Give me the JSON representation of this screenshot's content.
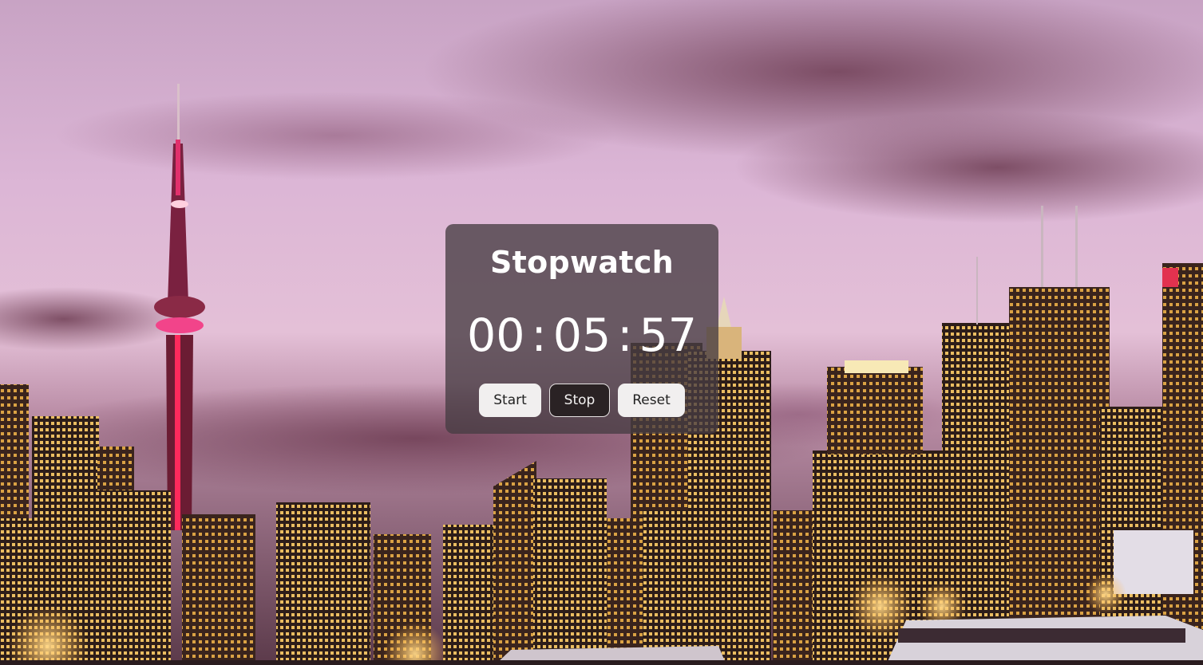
{
  "stopwatch": {
    "title": "Stopwatch",
    "hours": "00",
    "minutes": "05",
    "seconds": "57",
    "separator": ":"
  },
  "controls": {
    "start_label": "Start",
    "stop_label": "Stop",
    "reset_label": "Reset"
  },
  "colors": {
    "card_background": "#463c42",
    "button_light": "#f1efef",
    "button_dark": "#2a2224",
    "text": "#ffffff"
  }
}
